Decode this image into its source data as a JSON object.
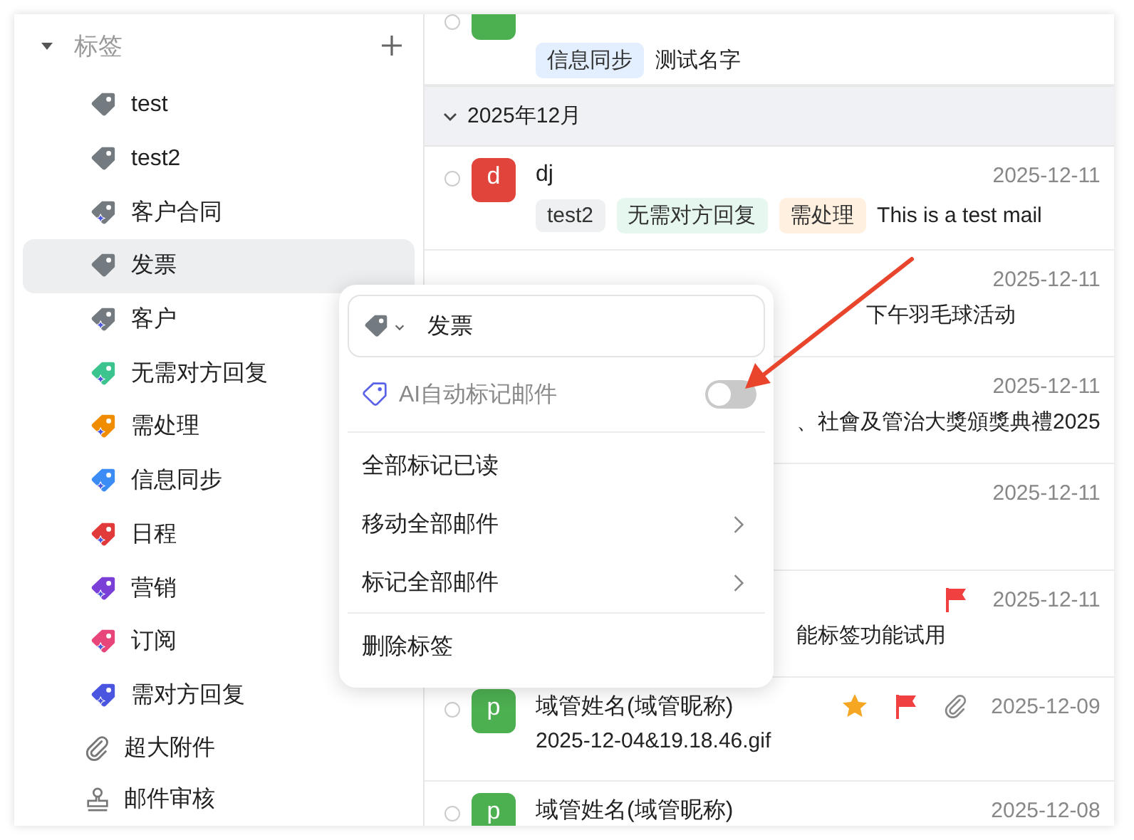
{
  "sidebar": {
    "section": {
      "title": "标签",
      "expanded": true
    },
    "items": [
      {
        "kind": "tag",
        "label": "test",
        "color": "#737b80",
        "ai": false,
        "selected": false
      },
      {
        "kind": "tag",
        "label": "test2",
        "color": "#737b80",
        "ai": false,
        "selected": false
      },
      {
        "kind": "tag",
        "label": "客户合同",
        "color": "#737b80",
        "ai": true,
        "selected": false
      },
      {
        "kind": "tag",
        "label": "发票",
        "color": "#737b80",
        "ai": false,
        "selected": true
      },
      {
        "kind": "tag",
        "label": "客户",
        "color": "#737b80",
        "ai": true,
        "selected": false
      },
      {
        "kind": "tag",
        "label": "无需对方回复",
        "color": "#3cc48f",
        "ai": true,
        "selected": false
      },
      {
        "kind": "tag",
        "label": "需处理",
        "color": "#f08c00",
        "ai": true,
        "selected": false
      },
      {
        "kind": "tag",
        "label": "信息同步",
        "color": "#3b8cf5",
        "ai": true,
        "selected": false
      },
      {
        "kind": "tag",
        "label": "日程",
        "color": "#e03a3a",
        "ai": true,
        "selected": false
      },
      {
        "kind": "tag",
        "label": "营销",
        "color": "#7a3fd6",
        "ai": true,
        "selected": false
      },
      {
        "kind": "tag",
        "label": "订阅",
        "color": "#e8457a",
        "ai": true,
        "selected": false
      },
      {
        "kind": "tag",
        "label": "需对方回复",
        "color": "#4a55e0",
        "ai": true,
        "selected": false
      },
      {
        "kind": "attachment",
        "label": "超大附件",
        "selected": false
      },
      {
        "kind": "review",
        "label": "邮件审核",
        "selected": false
      }
    ]
  },
  "mail_list": {
    "rows": [
      {
        "kind": "clipped",
        "selected": false,
        "avatar": {
          "color": "#4caf50"
        },
        "tags": [
          {
            "label": "信息同步",
            "color": "#e3efff"
          }
        ],
        "preview": "测试名字"
      },
      {
        "kind": "group",
        "label": "2025年12月",
        "expanded": true
      },
      {
        "kind": "mail",
        "selected": false,
        "avatar": {
          "letter": "d",
          "color": "#e0443a"
        },
        "name": "dj",
        "date": "2025-12-11",
        "tags": [
          {
            "label": "test2",
            "color": "#eef0f1"
          },
          {
            "label": "无需对方回复",
            "color": "#e6f7ef"
          },
          {
            "label": "需处理",
            "color": "#fff0e0"
          }
        ],
        "preview": "This is a test mail"
      },
      {
        "kind": "covered",
        "date": "2025-12-11",
        "preview": "下午羽毛球活动"
      },
      {
        "kind": "covered",
        "date": "2025-12-11",
        "preview": "、社會及管治大獎頒獎典禮2025"
      },
      {
        "kind": "covered",
        "date": "2025-12-11"
      },
      {
        "kind": "covered",
        "flagged": true,
        "date": "2025-12-11",
        "preview": "能标签功能试用"
      },
      {
        "kind": "mail",
        "selected": false,
        "avatar": {
          "letter": "p",
          "color": "#4caf50"
        },
        "name": "域管姓名(域管昵称)",
        "starred": true,
        "flagged": true,
        "attachment": true,
        "date": "2025-12-09",
        "preview": "2025-12-04&19.18.46.gif"
      },
      {
        "kind": "mail",
        "selected": false,
        "avatar": {
          "letter": "p",
          "color": "#4caf50"
        },
        "name": "域管姓名(域管昵称)",
        "date": "2025-12-08"
      }
    ]
  },
  "context_menu": {
    "tag_field": {
      "value": "发票"
    },
    "ai_toggle": {
      "label": "AI自动标记邮件",
      "on": false
    },
    "items": [
      {
        "label": "全部标记已读",
        "submenu": false,
        "divider_before": true
      },
      {
        "label": "移动全部邮件",
        "submenu": true,
        "divider_before": false
      },
      {
        "label": "标记全部邮件",
        "submenu": true,
        "divider_before": false
      },
      {
        "label": "删除标签",
        "submenu": false,
        "divider_before": true
      }
    ]
  }
}
